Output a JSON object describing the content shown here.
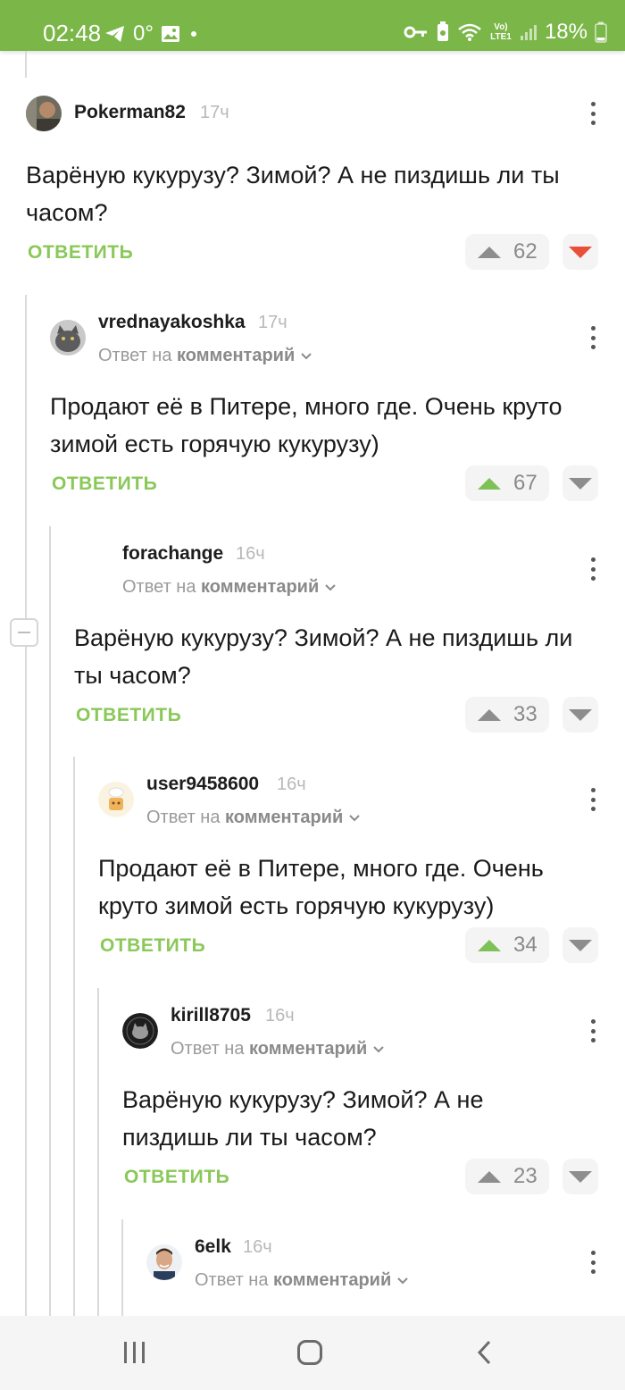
{
  "status_bar": {
    "time": "02:48",
    "temperature": "0°",
    "battery_percent": "18%",
    "network_label": "Vo) LTE1",
    "left_icons": [
      "telegram-icon",
      "image-icon",
      "dot-icon"
    ],
    "right_icons": [
      "key-icon",
      "battery-saver-icon",
      "wifi-icon",
      "lte-icon",
      "signal-icon",
      "battery-icon"
    ]
  },
  "comments": [
    {
      "username": "Pokerman82",
      "time": "17ч",
      "text": "Варёную кукурузу? Зимой? А не пиздишь ли ты часом?",
      "reply_label": "ОТВЕТИТЬ",
      "votes": "62",
      "upvoted": false,
      "downvoted": true,
      "avatar": "avatar-photo-man"
    },
    {
      "username": "vrednayakoshka",
      "time": "17ч",
      "reply_prefix": "Ответ на",
      "reply_target": "комментарий",
      "text": "Продают её в Питере, много где. Очень круто зимой есть горячую кукурузу)",
      "reply_label": "ОТВЕТИТЬ",
      "votes": "67",
      "upvoted": true,
      "downvoted": false,
      "avatar": "avatar-cat"
    },
    {
      "username": "forachange",
      "time": "16ч",
      "reply_prefix": "Ответ на",
      "reply_target": "комментарий",
      "text": "Варёную кукурузу? Зимой? А не пиздишь ли ты часом?",
      "reply_label": "ОТВЕТИТЬ",
      "votes": "33",
      "upvoted": false,
      "downvoted": false,
      "avatar": "none"
    },
    {
      "username": "user9458600",
      "time": "16ч",
      "reply_prefix": "Ответ на",
      "reply_target": "комментарий",
      "text": "Продают её в Питере, много где. Очень круто зимой есть горячую кукурузу)",
      "reply_label": "ОТВЕТИТЬ",
      "votes": "34",
      "upvoted": true,
      "downvoted": false,
      "avatar": "avatar-chef"
    },
    {
      "username": "kirill8705",
      "time": "16ч",
      "reply_prefix": "Ответ на",
      "reply_target": "комментарий",
      "text": "Варёную кукурузу? Зимой? А не пиздишь ли ты часом?",
      "reply_label": "ОТВЕТИТЬ",
      "votes": "23",
      "upvoted": false,
      "downvoted": false,
      "avatar": "avatar-dark-badge"
    },
    {
      "username": "6elk",
      "time": "16ч",
      "reply_prefix": "Ответ на",
      "reply_target": "комментарий",
      "avatar": "avatar-photo-smiling"
    }
  ],
  "nav_bar": {
    "icons": [
      "recent-apps-icon",
      "home-icon",
      "back-icon"
    ]
  },
  "colors": {
    "accent": "#7ab648",
    "reply_green": "#8ac858",
    "upvote_green": "#7fc157",
    "downvote_red": "#e8503a"
  }
}
